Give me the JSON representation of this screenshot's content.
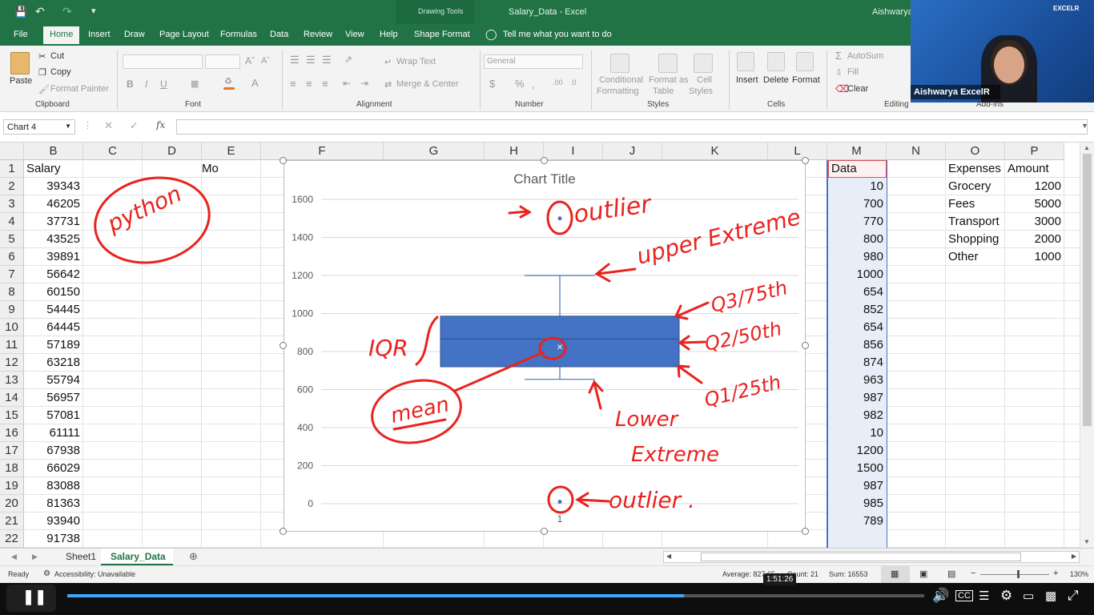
{
  "titlebar": {
    "doc_title": "Salary_Data - Excel",
    "context_tab": "Drawing Tools",
    "user": "Aishwarya"
  },
  "tabs": [
    "File",
    "Home",
    "Insert",
    "Draw",
    "Page Layout",
    "Formulas",
    "Data",
    "Review",
    "View",
    "Help",
    "Shape Format"
  ],
  "tell_me": "Tell me what you want to do",
  "ribbon": {
    "paste": "Paste",
    "cut": "Cut",
    "copy": "Copy",
    "format_painter": "Format Painter",
    "clipboard": "Clipboard",
    "font": "Font",
    "alignment": "Alignment",
    "number": "Number",
    "styles": "Styles",
    "cells": "Cells",
    "editing": "Editing",
    "addins": "Add-ins",
    "wrap_text": "Wrap Text",
    "merge_center": "Merge & Center",
    "general": "General",
    "conditional": "Conditional",
    "formatting": "Formatting",
    "format_as": "Format as",
    "table": "Table",
    "cell_styles_1": "Cell",
    "cell_styles_2": "Styles",
    "insert": "Insert",
    "delete": "Delete",
    "format": "Format",
    "autosum": "AutoSum",
    "fill": "Fill",
    "clear": "Clear",
    "bold": "B",
    "italic": "I",
    "underline": "U",
    "currency": "$",
    "percent": "%"
  },
  "name_box": "Chart 4",
  "fx": "fx",
  "columns": [
    "B",
    "C",
    "D",
    "E",
    "F",
    "G",
    "H",
    "I",
    "J",
    "K",
    "L",
    "M",
    "N",
    "O",
    "P"
  ],
  "rows": [
    "1",
    "2",
    "3",
    "4",
    "5",
    "6",
    "7",
    "8",
    "9",
    "10",
    "11",
    "12",
    "13",
    "14",
    "15",
    "16",
    "17",
    "18",
    "19",
    "20",
    "21",
    "22"
  ],
  "col_b": [
    "Salary",
    "39343",
    "46205",
    "37731",
    "43525",
    "39891",
    "56642",
    "60150",
    "54445",
    "64445",
    "57189",
    "63218",
    "55794",
    "56957",
    "57081",
    "61111",
    "67938",
    "66029",
    "83088",
    "81363",
    "93940",
    "91738"
  ],
  "e1_text": "Mo",
  "col_m": [
    "Data",
    "10",
    "700",
    "770",
    "800",
    "980",
    "1000",
    "654",
    "852",
    "654",
    "856",
    "874",
    "963",
    "987",
    "982",
    "10",
    "1200",
    "1500",
    "987",
    "985",
    "789"
  ],
  "col_o": [
    "Expenses",
    "Grocery",
    "Fees",
    "Transport",
    "Shopping",
    "Other"
  ],
  "col_p": [
    "Amount",
    "1200",
    "5000",
    "3000",
    "2000",
    "1000"
  ],
  "chart": {
    "title": "Chart Title",
    "x_label": "1"
  },
  "chart_data": {
    "type": "box",
    "title": "Chart Title",
    "categories": [
      "1"
    ],
    "y_ticks": [
      0,
      200,
      400,
      600,
      800,
      1000,
      1200,
      1400,
      1600
    ],
    "ylim": [
      0,
      1600
    ],
    "grid": true,
    "box": {
      "min": 654,
      "q1": 720,
      "median": 866,
      "q3": 986,
      "max": 1200,
      "mean": 828
    },
    "outliers": [
      10,
      1500
    ]
  },
  "annotations": {
    "python": "python",
    "outlier_top": "outlier",
    "upper_extreme": "upper Extreme",
    "q3": "Q3/75th",
    "q2": "Q2/50th",
    "q1": "Q1/25th",
    "iqr": "IQR",
    "mean": "mean",
    "lower_extreme_1": "Lower",
    "lower_extreme_2": "Extreme",
    "outlier_bottom": "outlier ."
  },
  "sheets": [
    "Sheet1",
    "Salary_Data"
  ],
  "status": {
    "ready": "Ready",
    "accessibility": "Accessibility: Unavailable",
    "average": "Average: 827.65",
    "count": "Count: 21",
    "sum": "Sum: 16553",
    "zoom": "130%"
  },
  "player": {
    "time": "1:51:26",
    "progress": 0.72
  },
  "webcam": {
    "label": "Aishwarya ExcelR",
    "brand": "EXCELR"
  },
  "colors": {
    "excel_green": "#217346",
    "chart_box": "#4472c4",
    "ink": "#e8231f"
  }
}
